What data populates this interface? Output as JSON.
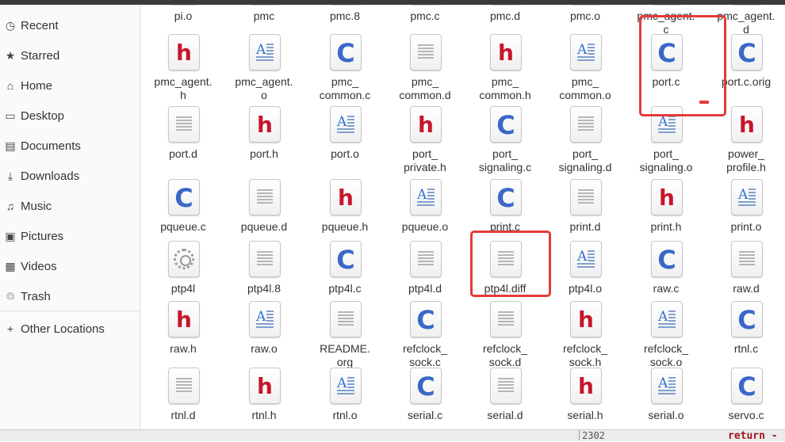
{
  "sidebar": {
    "items": [
      {
        "label": "Recent",
        "icon": "clock-icon",
        "glyph": "◷"
      },
      {
        "label": "Starred",
        "icon": "star-icon",
        "glyph": "★"
      },
      {
        "label": "Home",
        "icon": "home-icon",
        "glyph": "⌂"
      },
      {
        "label": "Desktop",
        "icon": "desktop-icon",
        "glyph": "▭"
      },
      {
        "label": "Documents",
        "icon": "document-icon",
        "glyph": "▤"
      },
      {
        "label": "Downloads",
        "icon": "download-icon",
        "glyph": "⤓"
      },
      {
        "label": "Music",
        "icon": "music-icon",
        "glyph": "♫"
      },
      {
        "label": "Pictures",
        "icon": "picture-icon",
        "glyph": "▣"
      },
      {
        "label": "Videos",
        "icon": "video-icon",
        "glyph": "▦"
      },
      {
        "label": "Trash",
        "icon": "trash-icon",
        "glyph": "♲"
      }
    ],
    "other": {
      "label": "Other Locations",
      "icon": "plus-icon",
      "glyph": "+"
    }
  },
  "files": [
    {
      "name": "pi.o",
      "type": "object"
    },
    {
      "name": "pmc",
      "type": "text"
    },
    {
      "name": "pmc.8",
      "type": "text"
    },
    {
      "name": "pmc.c",
      "type": "c"
    },
    {
      "name": "pmc.d",
      "type": "text"
    },
    {
      "name": "pmc.o",
      "type": "object"
    },
    {
      "name": "pmc_agent.\nc",
      "type": "c"
    },
    {
      "name": "pmc_agent.\nd",
      "type": "text"
    },
    {
      "name": "pmc_agent.\nh",
      "type": "h"
    },
    {
      "name": "pmc_agent.\no",
      "type": "object"
    },
    {
      "name": "pmc_\ncommon.c",
      "type": "c"
    },
    {
      "name": "pmc_\ncommon.d",
      "type": "text"
    },
    {
      "name": "pmc_\ncommon.h",
      "type": "h"
    },
    {
      "name": "pmc_\ncommon.o",
      "type": "object"
    },
    {
      "name": "port.c",
      "type": "c"
    },
    {
      "name": "port.c.orig",
      "type": "c"
    },
    {
      "name": "port.d",
      "type": "text"
    },
    {
      "name": "port.h",
      "type": "h"
    },
    {
      "name": "port.o",
      "type": "object"
    },
    {
      "name": "port_\nprivate.h",
      "type": "h"
    },
    {
      "name": "port_\nsignaling.c",
      "type": "c"
    },
    {
      "name": "port_\nsignaling.d",
      "type": "text"
    },
    {
      "name": "port_\nsignaling.o",
      "type": "object"
    },
    {
      "name": "power_\nprofile.h",
      "type": "h"
    },
    {
      "name": "pqueue.c",
      "type": "c"
    },
    {
      "name": "pqueue.d",
      "type": "text"
    },
    {
      "name": "pqueue.h",
      "type": "h"
    },
    {
      "name": "pqueue.o",
      "type": "object"
    },
    {
      "name": "print.c",
      "type": "c"
    },
    {
      "name": "print.d",
      "type": "text"
    },
    {
      "name": "print.h",
      "type": "h"
    },
    {
      "name": "print.o",
      "type": "object"
    },
    {
      "name": "ptp4l",
      "type": "exec"
    },
    {
      "name": "ptp4l.8",
      "type": "text"
    },
    {
      "name": "ptp4l.c",
      "type": "c"
    },
    {
      "name": "ptp4l.d",
      "type": "text"
    },
    {
      "name": "ptp4l.diff",
      "type": "text"
    },
    {
      "name": "ptp4l.o",
      "type": "object"
    },
    {
      "name": "raw.c",
      "type": "c"
    },
    {
      "name": "raw.d",
      "type": "text"
    },
    {
      "name": "raw.h",
      "type": "h"
    },
    {
      "name": "raw.o",
      "type": "object"
    },
    {
      "name": "README.\norg",
      "type": "text"
    },
    {
      "name": "refclock_\nsock.c",
      "type": "c"
    },
    {
      "name": "refclock_\nsock.d",
      "type": "text"
    },
    {
      "name": "refclock_\nsock.h",
      "type": "h"
    },
    {
      "name": "refclock_\nsock.o",
      "type": "object"
    },
    {
      "name": "rtnl.c",
      "type": "c"
    },
    {
      "name": "rtnl.d",
      "type": "text"
    },
    {
      "name": "rtnl.h",
      "type": "h"
    },
    {
      "name": "rtnl.o",
      "type": "object"
    },
    {
      "name": "serial.c",
      "type": "c"
    },
    {
      "name": "serial.d",
      "type": "text"
    },
    {
      "name": "serial.h",
      "type": "h"
    },
    {
      "name": "serial.o",
      "type": "object"
    },
    {
      "name": "servo.c",
      "type": "c"
    }
  ],
  "highlighted": [
    "port.c",
    "ptp4l.diff"
  ],
  "editor_strip": {
    "line_number": "2302",
    "keyword": "return -"
  },
  "colors": {
    "highlight": "#e23b3b",
    "h_glyph": "#c7162b",
    "c_glyph": "#3a68c9"
  }
}
